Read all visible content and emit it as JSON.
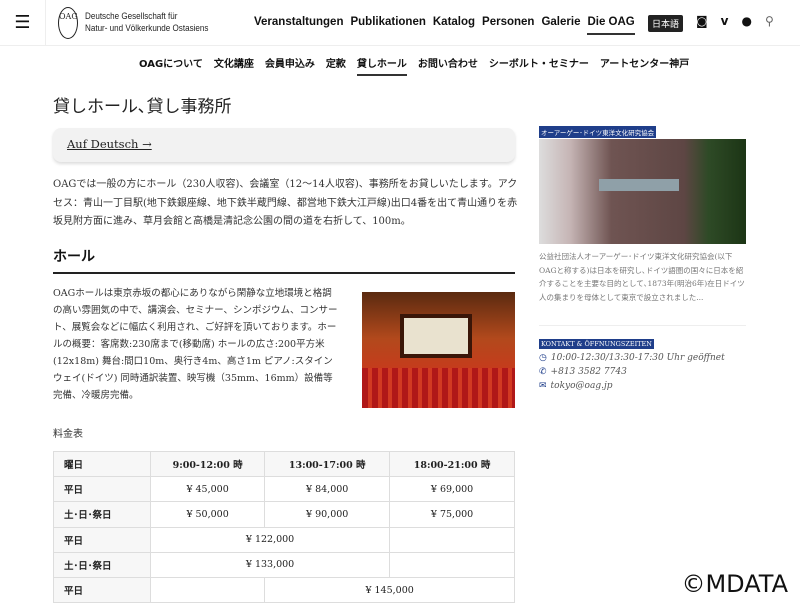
{
  "header": {
    "logo_mark": "OAG",
    "logo_line1": "Deutsche Gesellschaft für",
    "logo_line2": "Natur- und Völkerkunde Ostasiens",
    "nav": [
      "Veranstaltungen",
      "Publikationen",
      "Katalog",
      "Personen",
      "Galerie",
      "Die OAG"
    ],
    "lang": "日本語"
  },
  "subnav": [
    "OAGについて",
    "文化講座",
    "会員申込み",
    "定款",
    "貸しホール",
    "お問い合わせ",
    "シーボルト・セミナー",
    "アートセンター神戸"
  ],
  "page": {
    "title": "貸しホール､貸し事務所",
    "deutsch_link": "Auf Deutsch →",
    "intro": "OAGでは一般の方にホール（230人収容)、会議室（12～14人収容)、事務所をお貸しいたします。アクセス：青山一丁目駅(地下鉄銀座線、地下鉄半蔵門線、都営地下鉄大江戸線)出口4番を出て青山通りを赤坂見附方面に進み、草月会館と高橋是清記念公園の間の道を右折して、100m。",
    "hall_heading": "ホール",
    "hall_text": "OAGホールは東京赤坂の都心にありながら閑静な立地環境と格調の高い雰囲気の中で、講演会、セミナー、シンポジウム、コンサート、展覧会などに幅広く利用され、ご好評を頂いております。ホールの概要：客席数:230席まで(移動席) ホールの広さ:200平方米(12x18m) 舞台:間口10m、奥行き4m、高さ1m ピアノ:スタインウェイ(ドイツ) 同時通訳装置、映写機（35mm、16mm）設備等完備、冷暖房完備。",
    "price_caption": "料金表"
  },
  "table": {
    "headers": [
      "曜日",
      "9:00-12:00 時",
      "13:00-17:00 時",
      "18:00-21:00 時"
    ],
    "rows": [
      [
        "平日",
        "¥ 45,000",
        "¥ 84,000",
        "¥ 69,000"
      ],
      [
        "土･日･祭日",
        "¥ 50,000",
        "¥ 90,000",
        "¥ 75,000"
      ],
      [
        "平日",
        "¥ 122,000"
      ],
      [
        "土･日･祭日",
        "¥ 133,000"
      ],
      [
        "平日",
        "¥ 145,000"
      ]
    ]
  },
  "sidebar": {
    "tag1": "オーアーゲー･ドイツ東洋文化研究協会",
    "about": "公益社団法人オーアーゲー･ドイツ東洋文化研究協会(以下OAGと称する)は日本を研究し､ドイツ語圏の国々に日本を紹介することを主要な目的として､1873年(明治6年)在日ドイツ人の集まりを母体として東京で設立されました...",
    "tag2": "KONTAKT & ÖFFNUNGSZEITEN",
    "hours": "10:00-12:30/13:30-17:30 Uhr geöffnet",
    "phone": "+813 3582 7743",
    "email": "tokyo@oag.jp"
  },
  "watermark": "©MDATA",
  "colors": {
    "accent": "#1f3e8a"
  }
}
